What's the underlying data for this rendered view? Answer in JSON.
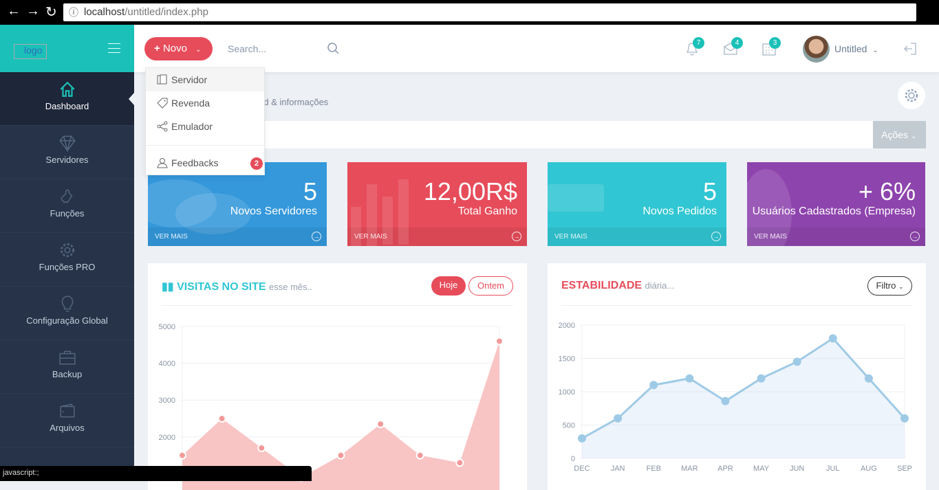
{
  "browser": {
    "url_host": "localhost",
    "url_path": "/untitled/index.php",
    "status": "javascript:;"
  },
  "logo_alt": "logo",
  "sidebar": {
    "items": [
      {
        "label": "Dashboard",
        "icon": "home-icon"
      },
      {
        "label": "Servidores",
        "icon": "diamond-icon"
      },
      {
        "label": "Funções",
        "icon": "puzzle-icon"
      },
      {
        "label": "Funções PRO",
        "icon": "gear-icon"
      },
      {
        "label": "Configuração Global",
        "icon": "bulb-icon"
      },
      {
        "label": "Backup",
        "icon": "briefcase-icon"
      },
      {
        "label": "Arquivos",
        "icon": "wallet-icon"
      }
    ]
  },
  "header": {
    "novo_label": "Novo",
    "search_placeholder": "Search...",
    "notifications": "7",
    "messages": "4",
    "calendar": "3",
    "user": "Untitled"
  },
  "dropdown": {
    "items": [
      {
        "label": "Servidor"
      },
      {
        "label": "Revenda"
      },
      {
        "label": "Emulador"
      },
      {
        "label": "Feedbacks",
        "badge": "2"
      }
    ]
  },
  "page": {
    "subtitle": "Dashboard & informações",
    "actions_label": "Ações"
  },
  "cards": [
    {
      "value": "5",
      "label": "Novos Servidores",
      "more": "VER MAIS",
      "color": "#3498db"
    },
    {
      "value": "12,00R$",
      "label": "Total Ganho",
      "more": "VER MAIS",
      "color": "#e74c5a"
    },
    {
      "value": "5",
      "label": "Novos Pedidos",
      "more": "VER MAIS",
      "color": "#31c6d3"
    },
    {
      "value": "+ 6%",
      "label": "Usuários Cadastrados (Empresa)",
      "more": "VER MAIS",
      "color": "#8e44ad"
    }
  ],
  "panels": {
    "visits": {
      "title": "VISITAS NO SITE",
      "sub": "esse mês..",
      "btn_today": "Hoje",
      "btn_yesterday": "Ontem"
    },
    "stability": {
      "title": "ESTABILIDADE",
      "sub": "diária...",
      "filter": "Filtro"
    }
  },
  "chart_data": [
    {
      "type": "area",
      "y_ticks": [
        "5000",
        "4000",
        "3000",
        "2000"
      ],
      "ylim": [
        0,
        5000
      ],
      "values": [
        1500,
        2500,
        1700,
        900,
        1500,
        2350,
        1500,
        1300,
        4600
      ],
      "color": "#f9c4c4",
      "grid": true
    },
    {
      "type": "area",
      "categories": [
        "DEC",
        "JAN",
        "FEB",
        "MAR",
        "APR",
        "MAY",
        "JUN",
        "JUL",
        "AUG",
        "SEP"
      ],
      "values": [
        300,
        600,
        1100,
        1200,
        860,
        1200,
        1450,
        1800,
        1200,
        600
      ],
      "y_ticks": [
        "2000",
        "1500",
        "1000",
        "500",
        "0"
      ],
      "ylim": [
        0,
        2000
      ],
      "color": "#9ecae6",
      "grid": true
    }
  ]
}
